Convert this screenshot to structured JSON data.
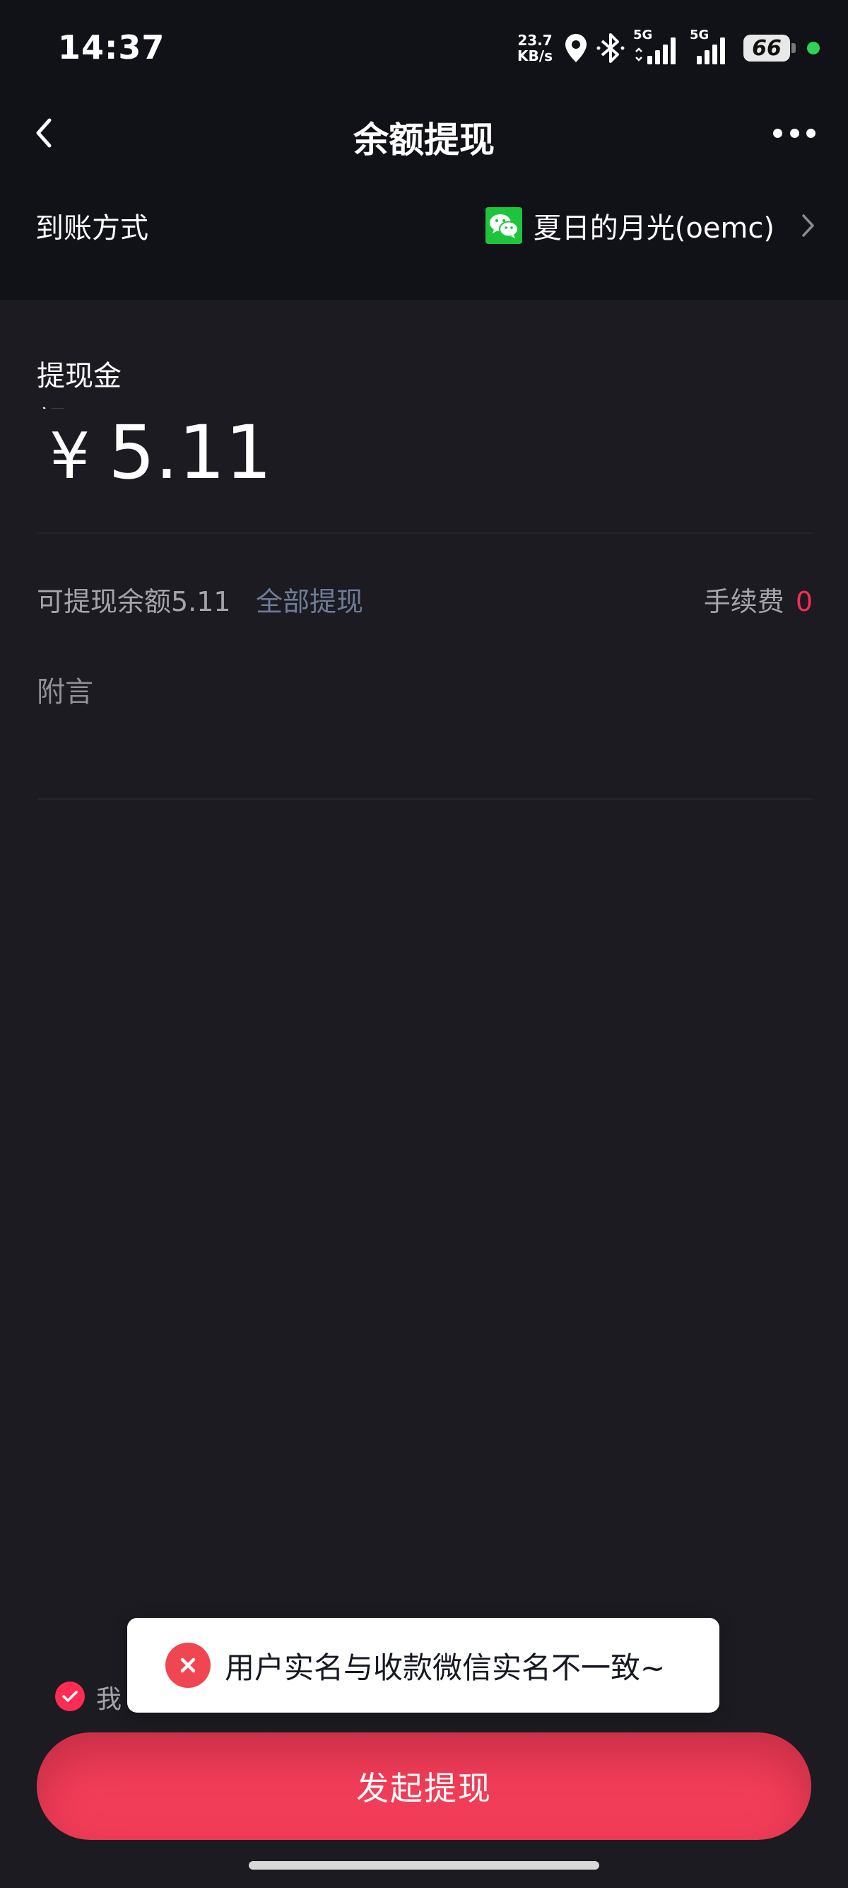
{
  "status_bar": {
    "time": "14:37",
    "net_speed_value": "23.7",
    "net_speed_unit": "KB/s",
    "signal1_tag": "5G",
    "signal2_tag": "5G",
    "battery": "66",
    "icons": [
      "location-icon",
      "bluetooth-icon",
      "signal-5g-icon",
      "signal-5g-icon",
      "battery-icon"
    ]
  },
  "nav": {
    "title": "余额提现"
  },
  "payout_method": {
    "label": "到账方式",
    "account_name": "夏日的月光(oemc)"
  },
  "amount": {
    "label": "提现金额",
    "currency": "¥",
    "value": "5.11"
  },
  "available": {
    "text": "可提现余额5.11",
    "withdraw_all": "全部提现",
    "fee_label": "手续费",
    "fee_value": "0"
  },
  "remark": {
    "placeholder": "附言"
  },
  "agreement": {
    "text": "我",
    "checked": true
  },
  "toast": {
    "message": "用户实名与收款微信实名不一致~"
  },
  "submit": {
    "label": "发起提现"
  },
  "colors": {
    "accent": "#fe2c55",
    "wechat_green": "#1fc43d",
    "background": "#1b1b21",
    "header_background": "#111118"
  }
}
